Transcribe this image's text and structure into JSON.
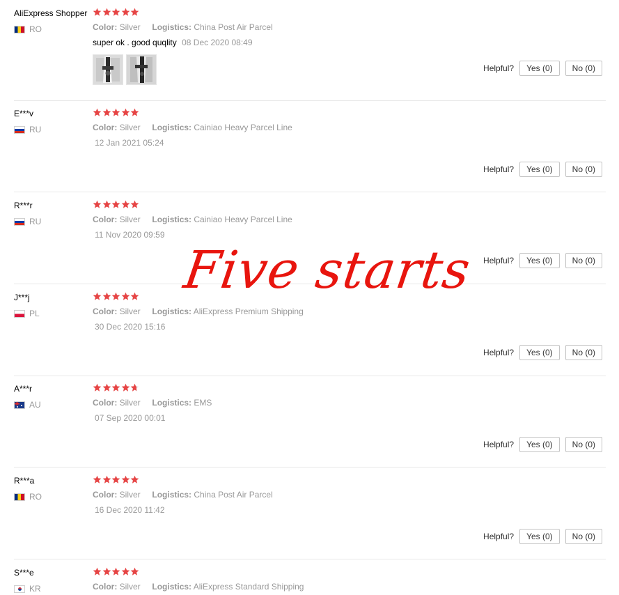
{
  "star_color": "#e64545",
  "helpful_label": "Helpful?",
  "color_key": "Color:",
  "logistics_key": "Logistics:",
  "reviews": [
    {
      "user": "AliExpress Shopper",
      "country": "RO",
      "flag": "ro-flag-icon",
      "rating": 5,
      "color": "Silver",
      "logistics": "China Post Air Parcel",
      "text": "super ok . good quqlity",
      "date": "08 Dec 2020 08:49",
      "yes": "Yes (0)",
      "no": "No (0)"
    },
    {
      "user": "E***v",
      "country": "RU",
      "flag": "ru-flag-icon",
      "rating": 5,
      "color": "Silver",
      "logistics": "Cainiao Heavy Parcel Line",
      "date": "12 Jan 2021 05:24",
      "yes": "Yes (0)",
      "no": "No (0)"
    },
    {
      "user": "R***r",
      "country": "RU",
      "flag": "ru-flag-icon",
      "rating": 5,
      "color": "Silver",
      "logistics": "Cainiao Heavy Parcel Line",
      "date": "11 Nov 2020 09:59",
      "yes": "Yes (0)",
      "no": "No (0)"
    },
    {
      "user": "J***j",
      "country": "PL",
      "flag": "pl-flag-icon",
      "rating": 5,
      "color": "Silver",
      "logistics": "AliExpress Premium Shipping",
      "date": "30 Dec 2020 15:16",
      "yes": "Yes (0)",
      "no": "No (0)"
    },
    {
      "user": "A***r",
      "country": "AU",
      "flag": "au-flag-icon",
      "rating": 4.7,
      "color": "Silver",
      "logistics": "EMS",
      "date": "07 Sep 2020 00:01",
      "yes": "Yes (0)",
      "no": "No (0)"
    },
    {
      "user": "R***a",
      "country": "RO",
      "flag": "ro-flag-icon",
      "rating": 5,
      "color": "Silver",
      "logistics": "China Post Air Parcel",
      "date": "16 Dec 2020 11:42",
      "yes": "Yes (0)",
      "no": "No (0)"
    },
    {
      "user": "S***e",
      "country": "KR",
      "flag": "kr-flag-icon",
      "rating": 5,
      "color": "Silver",
      "logistics": "AliExpress Standard Shipping"
    }
  ],
  "overlay_text": "Five starts"
}
